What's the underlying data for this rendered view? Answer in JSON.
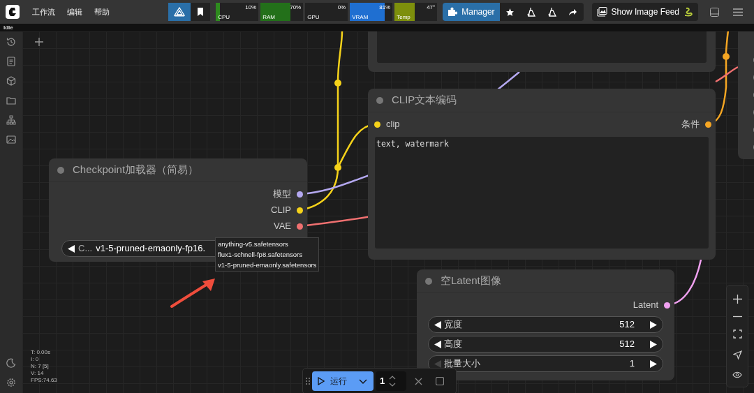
{
  "menu": [
    {
      "label": "工作流"
    },
    {
      "label": "编辑"
    },
    {
      "label": "帮助"
    }
  ],
  "monitors": [
    {
      "label": "CPU",
      "reading": "10%",
      "level": 0.1,
      "color": "#2e8b1e"
    },
    {
      "label": "RAM",
      "reading": "70%",
      "level": 0.7,
      "color": "#23701a"
    },
    {
      "label": "GPU",
      "reading": "0%",
      "level": 0
    },
    {
      "label": "VRAM",
      "reading": "81%",
      "level": 0.81,
      "color": "#1f6fd1"
    },
    {
      "label": "Temp",
      "reading": "47°",
      "level": 0.47,
      "color": "#7d8f0c"
    }
  ],
  "manager_button": "Manager",
  "image_feed_button": "Show Image Feed",
  "status": "Idle",
  "nodes": [
    {
      "title": "CLIP文本编码",
      "inputs": [
        {
          "label": "clip",
          "color": "#f5d21a"
        }
      ],
      "outputs": [
        {
          "label": "条件",
          "color": "#f5a623"
        }
      ],
      "text": "text, watermark"
    },
    {
      "title": "Checkpoint加载器（简易）",
      "outputs": [
        {
          "label": "模型",
          "color": "#b4a8f0"
        },
        {
          "label": "CLIP",
          "color": "#f5d21a"
        },
        {
          "label": "VAE",
          "color": "#f07070"
        }
      ],
      "widgets": [
        {
          "kind": "combo",
          "label": "C...",
          "value": "v1-5-pruned-emaonly-fp16."
        }
      ]
    },
    {
      "title": "空Latent图像",
      "outputs": [
        {
          "label": "Latent",
          "color": "#f0a0f0"
        }
      ],
      "widgets": [
        {
          "kind": "number",
          "label": "宽度",
          "value": "512",
          "at_min": false
        },
        {
          "kind": "number",
          "label": "高度",
          "value": "512",
          "at_min": false
        },
        {
          "kind": "number",
          "label": "批量大小",
          "value": "1",
          "at_min": true
        }
      ]
    }
  ],
  "dropdown": {
    "options": [
      "anything-v5.safetensors",
      "flux1-schnell-fp8.safetensors",
      "v1-5-pruned-emaonly.safetensors"
    ]
  },
  "stats": [
    "T: 0.00s",
    "I: 0",
    "N: 7 [5]",
    "V: 14",
    "FPS:74.63"
  ],
  "run_bar": {
    "run_label": "运行",
    "batch_count": "1"
  }
}
